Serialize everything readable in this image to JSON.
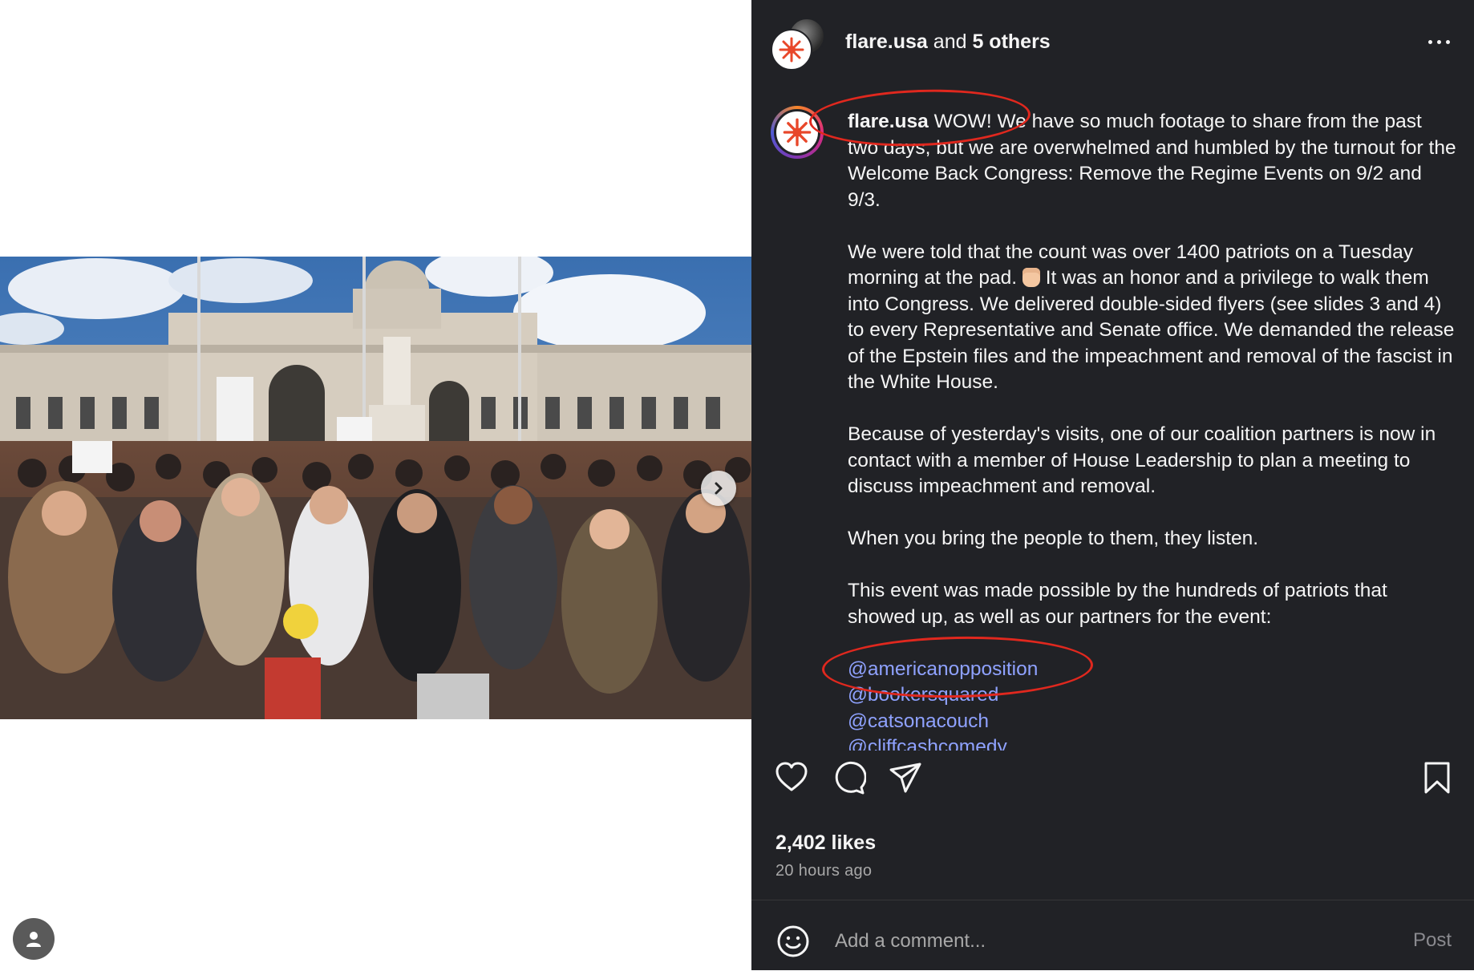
{
  "header": {
    "username": "flare.usa",
    "joiner": " and ",
    "others": "5 others"
  },
  "caption": {
    "username": "flare.usa",
    "paragraphs": [
      "WOW! We have so much footage to share from the past two days, but we are overwhelmed and humbled by the turnout for the Welcome Back Congress: Remove the Regime Events on 9/2 and 9/3.",
      "We were told that the count was over 1400 patriots on a Tuesday morning at the pad.",
      "It was an honor and a privilege to walk them into Congress. We delivered double-sided flyers (see slides 3 and 4) to every Representative and Senate office. We demanded the release of the Epstein files and the impeachment and removal of the fascist in the White House.",
      "Because of yesterday's visits, one of our coalition partners is now in contact with a member of House Leadership to plan a meeting to discuss impeachment and removal.",
      "When you bring the people to them, they listen.",
      "This event was made possible by the hundreds of patriots that showed up, as well as our partners for the event:"
    ],
    "mentions": [
      "@americanopposition",
      "@bookersquared",
      "@catsonacouch",
      "@cliffcashcomedy"
    ]
  },
  "engagement": {
    "likes": "2,402 likes",
    "time_ago": "20 hours ago"
  },
  "comment": {
    "placeholder": "Add a comment...",
    "post_label": "Post"
  },
  "icons": {
    "more": "more-horizontal-icon",
    "like": "heart-icon",
    "comment": "comment-icon",
    "share": "send-icon",
    "save": "bookmark-icon",
    "emoji": "smiley-icon",
    "next": "chevron-right-icon",
    "profile": "person-icon"
  },
  "colors": {
    "panel_bg": "#212226",
    "mention": "#8fa2ff",
    "annotation": "#e0281e"
  }
}
